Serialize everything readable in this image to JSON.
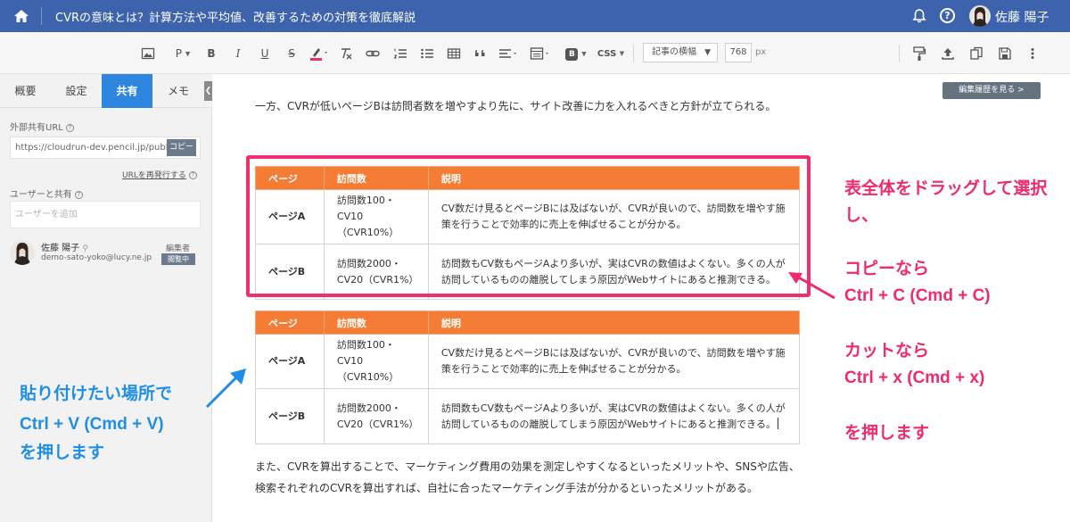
{
  "topbar": {
    "title": "CVRの意味とは？計算方法や平均値、改善するための対策を徹底解説",
    "user_name": "佐藤 陽子",
    "help_glyph": "?",
    "accent": "#3e63ad"
  },
  "toolbar": {
    "paragraph_label": "P",
    "bold_label": "B",
    "italic_label": "I",
    "underline_label": "U",
    "strike_label": "S",
    "block_label": "B",
    "css_label": "CSS",
    "font_select": "記事の横幅",
    "width_value": "768",
    "width_unit": "px"
  },
  "sidebar": {
    "tabs": [
      {
        "label": "概要",
        "active": false
      },
      {
        "label": "設定",
        "active": false
      },
      {
        "label": "共有",
        "active": true
      },
      {
        "label": "メモ",
        "active": false
      }
    ],
    "external_url_label": "外部共有URL",
    "external_url_value": "https://cloudrun-dev.pencil.jp/public-",
    "copy_button": "コピー",
    "reissue_link": "URLを再発行する",
    "share_label": "ユーザーと共有",
    "add_user_placeholder": "ユーザーを追加",
    "member": {
      "name": "佐藤 陽子",
      "email": "demo-sato-yoko@lucy.ne.jp",
      "role": "編集者",
      "status": "閲覧中"
    }
  },
  "main": {
    "history_button": "編集履歴を見る >",
    "para1": "一方、CVRが低いページBは訪問者数を増やすより先に、サイト改善に力を入れるべきと方針が立てられる。",
    "para2": "また、CVRを算出することで、マーケティング費用の効果を測定しやすくなるといったメリットや、SNSや広告、検索それぞれのCVRを算出すれば、自社に合ったマーケティング手法が分かるといったメリットがある。",
    "table": {
      "headers": [
        "ページ",
        "訪問数",
        "説明"
      ],
      "rows": [
        [
          "ページA",
          "訪問数100・CV10（CVR10%）",
          "CV数だけ見るとページBには及ばないが、CVRが良いので、訪問数を増やす施策を行うことで効率的に売上を伸ばせることが分かる。"
        ],
        [
          "ページB",
          "訪問数2000・CV20（CVR1%）",
          "訪問数もCV数もページAより多いが、実はCVRの数値はよくない。多くの人が訪問しているものの離脱してしまう原因がWebサイトにあると推測できる。"
        ]
      ],
      "header_color": "#f47c34"
    }
  },
  "annotations": {
    "right": [
      "表全体をドラッグして選択",
      "し、",
      "コピーなら",
      "Ctrl + C (Cmd + C)",
      "カットなら",
      "Ctrl + x (Cmd + x)",
      "を押します"
    ],
    "left": [
      "貼り付けたい場所で",
      "Ctrl + V (Cmd + V)",
      "を押します"
    ],
    "pink": "#ef2b6d",
    "blue": "#1f8ee8"
  }
}
